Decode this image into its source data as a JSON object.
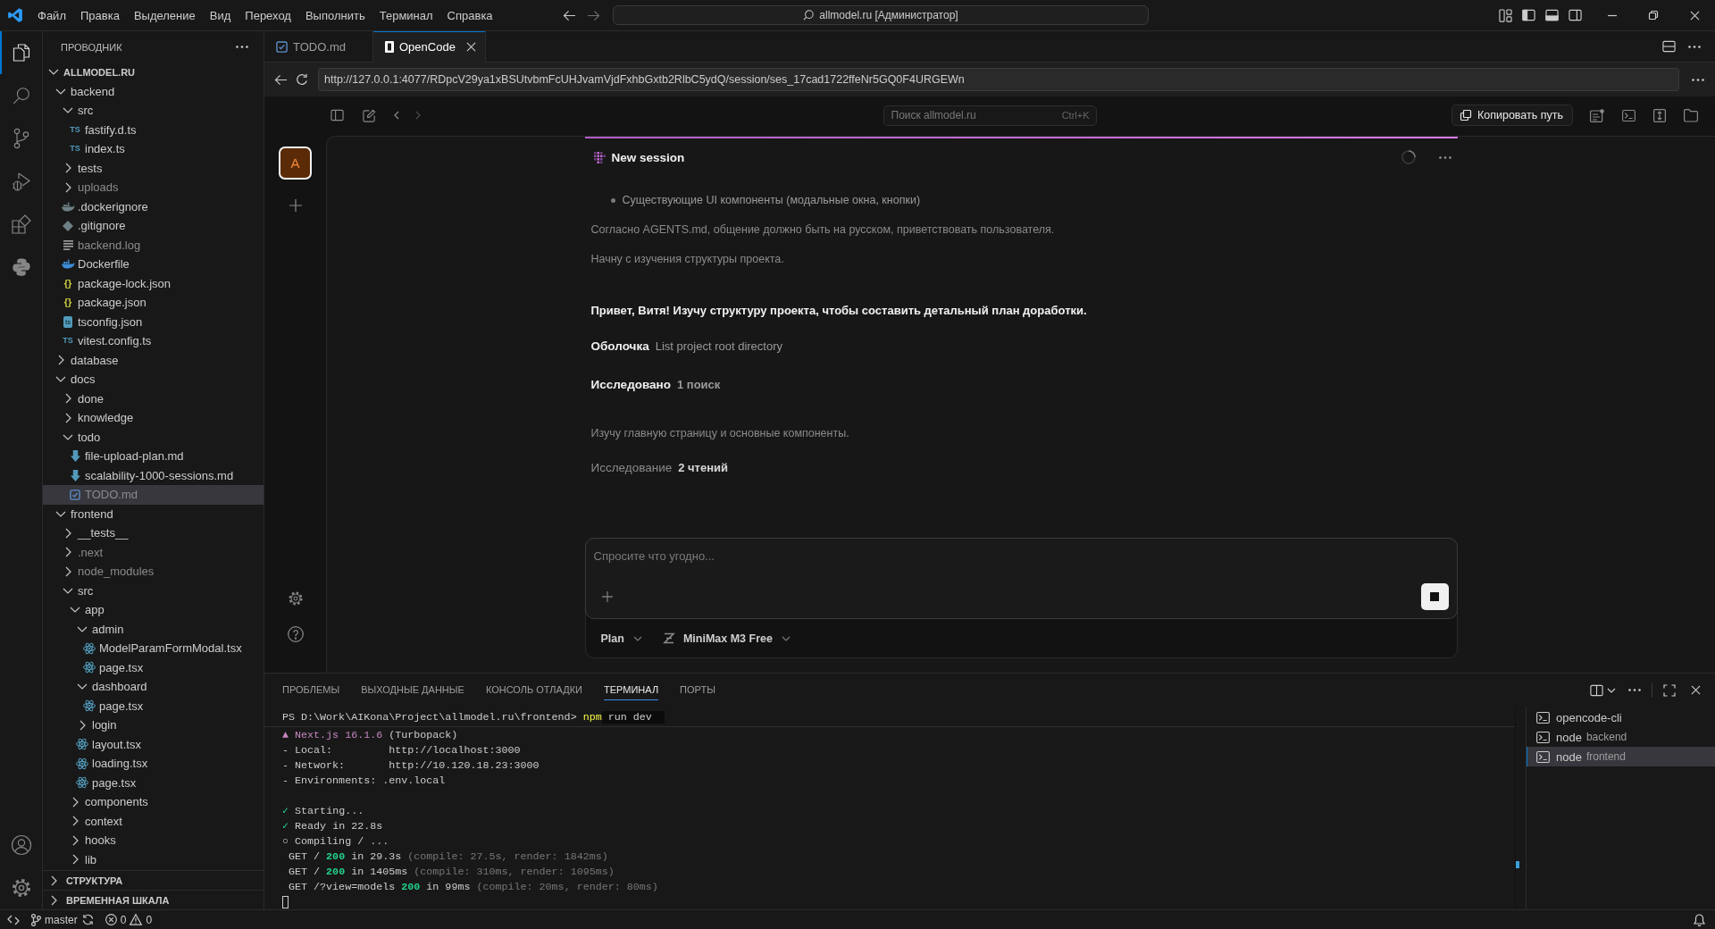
{
  "title_bar": {
    "menu": [
      "Файл",
      "Правка",
      "Выделение",
      "Вид",
      "Переход",
      "Выполнить",
      "Терминал",
      "Справка"
    ],
    "command_center": "allmodel.ru [Администратор]"
  },
  "activity_bar": {
    "items": [
      {
        "kind": "explorer",
        "selected": true
      },
      {
        "kind": "search",
        "selected": false
      },
      {
        "kind": "source_control",
        "selected": false
      },
      {
        "kind": "run_debug",
        "selected": false
      },
      {
        "kind": "extensions",
        "selected": false
      },
      {
        "kind": "python",
        "selected": false
      }
    ],
    "bottom": [
      {
        "kind": "account"
      },
      {
        "kind": "settings"
      }
    ]
  },
  "explorer": {
    "title": "ПРОВОДНИК",
    "tree": [
      {
        "label": "ALLMODEL.RU",
        "kind": "root",
        "expanded": true,
        "selected": false,
        "ignored": false,
        "children": [
          {
            "label": "backend",
            "kind": "folder",
            "expanded": true,
            "selected": false,
            "ignored": false,
            "children": [
              {
                "label": "src",
                "kind": "folder",
                "expanded": true,
                "selected": false,
                "ignored": false,
                "children": [
                  {
                    "label": "fastify.d.ts",
                    "kind": "ts",
                    "glyph": "TS",
                    "selected": false,
                    "ignored": false
                  },
                  {
                    "label": "index.ts",
                    "kind": "ts",
                    "glyph": "TS",
                    "selected": false,
                    "ignored": false
                  }
                ]
              },
              {
                "label": "tests",
                "kind": "folder",
                "expanded": false,
                "selected": false,
                "ignored": false
              },
              {
                "label": "uploads",
                "kind": "folder",
                "expanded": false,
                "selected": false,
                "ignored": true
              },
              {
                "label": ".dockerignore",
                "kind": "dockerignore",
                "selected": false,
                "ignored": false
              },
              {
                "label": ".gitignore",
                "kind": "git",
                "selected": false,
                "ignored": false
              },
              {
                "label": "backend.log",
                "kind": "log",
                "selected": false,
                "ignored": true
              },
              {
                "label": "Dockerfile",
                "kind": "docker",
                "selected": false,
                "ignored": false
              },
              {
                "label": "package-lock.json",
                "kind": "json",
                "glyph": "{}",
                "selected": false,
                "ignored": false
              },
              {
                "label": "package.json",
                "kind": "json",
                "glyph": "{}",
                "selected": false,
                "ignored": false
              },
              {
                "label": "tsconfig.json",
                "kind": "tsconfig",
                "glyph": "ts",
                "selected": false,
                "ignored": false
              },
              {
                "label": "vitest.config.ts",
                "kind": "ts",
                "glyph": "TS",
                "selected": false,
                "ignored": false
              }
            ]
          },
          {
            "label": "database",
            "kind": "folder",
            "expanded": false,
            "selected": false,
            "ignored": false
          },
          {
            "label": "docs",
            "kind": "folder",
            "expanded": true,
            "selected": false,
            "ignored": false,
            "children": [
              {
                "label": "done",
                "kind": "folder",
                "expanded": false,
                "selected": false,
                "ignored": false
              },
              {
                "label": "knowledge",
                "kind": "folder",
                "expanded": false,
                "selected": false,
                "ignored": false
              },
              {
                "label": "todo",
                "kind": "folder",
                "expanded": true,
                "selected": false,
                "ignored": false,
                "children": [
                  {
                    "label": "file-upload-plan.md",
                    "kind": "markdown",
                    "selected": false,
                    "ignored": false
                  },
                  {
                    "label": "scalability-1000-sessions.md",
                    "kind": "markdown",
                    "selected": false,
                    "ignored": false
                  },
                  {
                    "label": "TODO.md",
                    "kind": "todo",
                    "selected": true,
                    "ignored": true
                  }
                ]
              }
            ]
          },
          {
            "label": "frontend",
            "kind": "folder",
            "expanded": true,
            "selected": false,
            "ignored": false,
            "children": [
              {
                "label": "__tests__",
                "kind": "folder",
                "expanded": false,
                "selected": false,
                "ignored": false
              },
              {
                "label": ".next",
                "kind": "folder",
                "expanded": false,
                "selected": false,
                "ignored": true
              },
              {
                "label": "node_modules",
                "kind": "folder",
                "expanded": false,
                "selected": false,
                "ignored": true
              },
              {
                "label": "src",
                "kind": "folder",
                "expanded": true,
                "selected": false,
                "ignored": false,
                "children": [
                  {
                    "label": "app",
                    "kind": "folder",
                    "expanded": true,
                    "selected": false,
                    "ignored": false,
                    "children": [
                      {
                        "label": "admin",
                        "kind": "folder",
                        "expanded": true,
                        "selected": false,
                        "ignored": false,
                        "children": [
                          {
                            "label": "ModelParamFormModal.tsx",
                            "kind": "tsx",
                            "selected": false,
                            "ignored": false
                          },
                          {
                            "label": "page.tsx",
                            "kind": "tsx",
                            "selected": false,
                            "ignored": false
                          }
                        ]
                      },
                      {
                        "label": "dashboard",
                        "kind": "folder",
                        "expanded": true,
                        "selected": false,
                        "ignored": false,
                        "children": [
                          {
                            "label": "page.tsx",
                            "kind": "tsx",
                            "selected": false,
                            "ignored": false
                          }
                        ]
                      },
                      {
                        "label": "login",
                        "kind": "folder",
                        "expanded": false,
                        "selected": false,
                        "ignored": false
                      },
                      {
                        "label": "layout.tsx",
                        "kind": "tsx",
                        "selected": false,
                        "ignored": false
                      },
                      {
                        "label": "loading.tsx",
                        "kind": "tsx",
                        "selected": false,
                        "ignored": false
                      },
                      {
                        "label": "page.tsx",
                        "kind": "tsx",
                        "selected": false,
                        "ignored": false
                      }
                    ]
                  },
                  {
                    "label": "components",
                    "kind": "folder",
                    "expanded": false,
                    "selected": false,
                    "ignored": false
                  },
                  {
                    "label": "context",
                    "kind": "folder",
                    "expanded": false,
                    "selected": false,
                    "ignored": false
                  },
                  {
                    "label": "hooks",
                    "kind": "folder",
                    "expanded": false,
                    "selected": false,
                    "ignored": false
                  },
                  {
                    "label": "lib",
                    "kind": "folder",
                    "expanded": false,
                    "selected": false,
                    "ignored": false
                  }
                ]
              }
            ]
          }
        ]
      }
    ],
    "sections": [
      {
        "label": "СТРУКТУРА",
        "expanded": false
      },
      {
        "label": "ВРЕМЕННАЯ ШКАЛА",
        "expanded": false
      }
    ]
  },
  "editor": {
    "tabs": [
      {
        "label": "TODO.md",
        "kind": "todo",
        "selected": false
      },
      {
        "label": "OpenCode",
        "kind": "preview",
        "selected": true
      }
    ],
    "url": "http://127.0.0.1:4077/RDpcV29ya1xBSUtvbmFcUHJvamVjdFxhbGxtb2RlbC5ydQ/session/ses_17cad1722ffeNr5GQ0F4URGEWn"
  },
  "opencode": {
    "toolbar": {
      "search_placeholder": "Поиск allmodel.ru",
      "shortcut": "Ctrl+K",
      "copy_button": "Копировать путь"
    },
    "projects": [
      {
        "initial": "A",
        "selected": true
      }
    ],
    "session": {
      "title": "New session",
      "busy": true,
      "messages": [
        {
          "kind": "bullet",
          "text": "Существующие UI компоненты (модальные окна, кнопки)"
        },
        {
          "kind": "note",
          "text": "Согласно AGENTS.md, общение должно быть на русском, приветствовать пользователя."
        },
        {
          "kind": "note",
          "text": "Начну с изучения структуры проекта."
        },
        {
          "kind": "reply",
          "text": "Привет, Витя! Изучу структуру проекта, чтобы составить детальный план доработки."
        },
        {
          "kind": "shell",
          "label": "Оболочка",
          "detail": "List project root directory",
          "done": true
        },
        {
          "kind": "explore",
          "label": "Исследовано",
          "detail": "1 поиск",
          "done": true
        },
        {
          "kind": "note",
          "text": "Изучу главную страницу и основные компоненты."
        },
        {
          "kind": "explore",
          "label": "Исследование",
          "detail": "2 чтений",
          "done": false
        }
      ]
    },
    "prompt": {
      "placeholder": "Спросите что угодно...",
      "mode": "Plan",
      "model": "MiniMax M3 Free"
    }
  },
  "panel": {
    "tabs": [
      {
        "label": "ПРОБЛЕМЫ",
        "selected": false
      },
      {
        "label": "ВЫХОДНЫЕ ДАННЫЕ",
        "selected": false
      },
      {
        "label": "КОНСОЛЬ ОТЛАДКИ",
        "selected": false
      },
      {
        "label": "ТЕРМИНАЛ",
        "selected": true
      },
      {
        "label": "ПОРТЫ",
        "selected": false
      }
    ],
    "terminal": {
      "lines": [
        {
          "kind": "prompt",
          "segments": [
            {
              "text": "PS D:\\Work\\AIKona\\Project\\allmodel.ru\\frontend> ",
              "kind": "plain"
            },
            {
              "text": "npm",
              "kind": "command"
            },
            {
              "text": " run dev",
              "kind": "typed"
            }
          ]
        },
        {
          "kind": "output",
          "segments": [
            {
              "text": "▲ Next.js 16.1.6",
              "kind": "accent"
            },
            {
              "text": " (Turbopack)",
              "kind": "plain"
            }
          ]
        },
        {
          "kind": "output",
          "segments": [
            {
              "text": "- Local:         http://localhost:3000",
              "kind": "plain"
            }
          ]
        },
        {
          "kind": "output",
          "segments": [
            {
              "text": "- Network:       http://10.120.18.23:3000",
              "kind": "plain"
            }
          ]
        },
        {
          "kind": "output",
          "segments": [
            {
              "text": "- Environments: .env.local",
              "kind": "plain"
            }
          ]
        },
        {
          "kind": "blank"
        },
        {
          "kind": "output",
          "segments": [
            {
              "text": "✓",
              "kind": "success"
            },
            {
              "text": " Starting...",
              "kind": "plain"
            }
          ]
        },
        {
          "kind": "output",
          "segments": [
            {
              "text": "✓",
              "kind": "success"
            },
            {
              "text": " Ready in 22.8s",
              "kind": "plain"
            }
          ]
        },
        {
          "kind": "output",
          "segments": [
            {
              "text": "○ Compiling / ...",
              "kind": "plain"
            }
          ]
        },
        {
          "kind": "output",
          "segments": [
            {
              "text": " GET / ",
              "kind": "plain"
            },
            {
              "text": "200",
              "kind": "success"
            },
            {
              "text": " in 29.3s ",
              "kind": "plain"
            },
            {
              "text": "(compile: 27.5s, render: 1842ms)",
              "kind": "dim"
            }
          ]
        },
        {
          "kind": "output",
          "segments": [
            {
              "text": " GET / ",
              "kind": "plain"
            },
            {
              "text": "200",
              "kind": "success"
            },
            {
              "text": " in 1405ms ",
              "kind": "plain"
            },
            {
              "text": "(compile: 310ms, render: 1095ms)",
              "kind": "dim"
            }
          ]
        },
        {
          "kind": "output",
          "segments": [
            {
              "text": " GET /?view=models ",
              "kind": "plain"
            },
            {
              "text": "200",
              "kind": "success"
            },
            {
              "text": " in 99ms ",
              "kind": "plain"
            },
            {
              "text": "(compile: 20ms, render: 80ms)",
              "kind": "dim"
            }
          ]
        },
        {
          "kind": "cursor"
        }
      ]
    },
    "sessions": [
      {
        "name": "opencode-cli",
        "selected": false
      },
      {
        "name": "node",
        "detail": "backend",
        "selected": false
      },
      {
        "name": "node",
        "detail": "frontend",
        "selected": true
      }
    ]
  },
  "status_bar": {
    "branch": "master",
    "errors": "0",
    "warnings": "0"
  }
}
